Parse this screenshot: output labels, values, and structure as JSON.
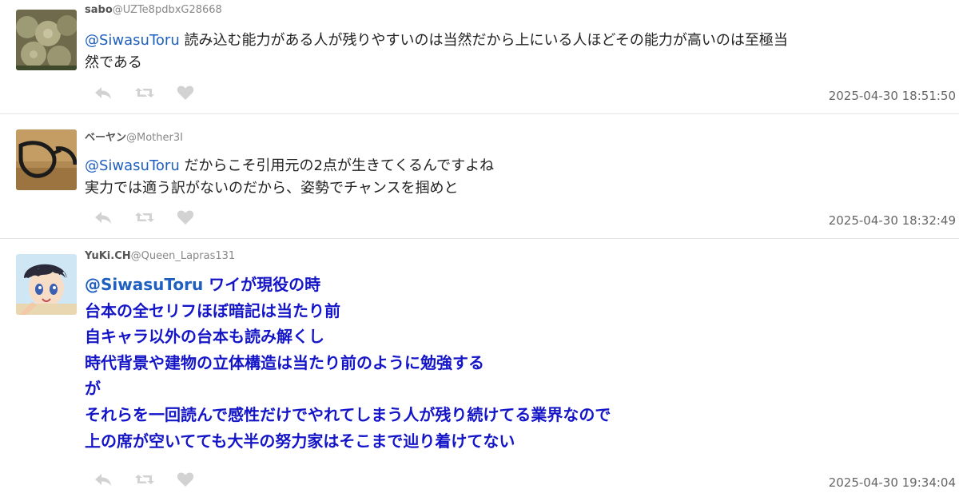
{
  "tweets": [
    {
      "display_name": "sabo",
      "handle": "@UZTe8pdbxG28668",
      "mention": "@SiwasuToru",
      "lines": [
        " 読み込む能力がある人が残りやすいのは当然だから上にいる人ほどその能力が高いのは至極当",
        "然である"
      ],
      "timestamp": "2025-04-30 18:51:50"
    },
    {
      "display_name": "ベーヤン",
      "handle": "@Mother3I",
      "mention": "@SiwasuToru",
      "lines": [
        " だからこそ引用元の2点が生きてくるんですよね",
        "実力では適う訳がないのだから、姿勢でチャンスを掴めと"
      ],
      "timestamp": "2025-04-30 18:32:49"
    },
    {
      "display_name": "YuKi.CH",
      "handle": "@Queen_Lapras131",
      "mention": "@SiwasuToru",
      "lines": [
        " ワイが現役の時",
        "台本の全セリフほぼ暗記は当たり前",
        "自キャラ以外の台本も読み解くし",
        "時代背景や建物の立体構造は当たり前のように勉強する",
        "が",
        "それらを一回読んで感性だけでやれてしまう人が残り続けてる業界なので",
        "上の席が空いてても大半の努力家はそこまで辿り着けてない"
      ],
      "timestamp": "2025-04-30 19:34:04"
    }
  ],
  "icons": {
    "reply": "reply-icon",
    "retweet": "retweet-icon",
    "like": "heart-icon"
  },
  "colors": {
    "mention": "#1f5fbf",
    "highlight_text": "#1515c8",
    "icon_gray": "#d2d2d2"
  }
}
